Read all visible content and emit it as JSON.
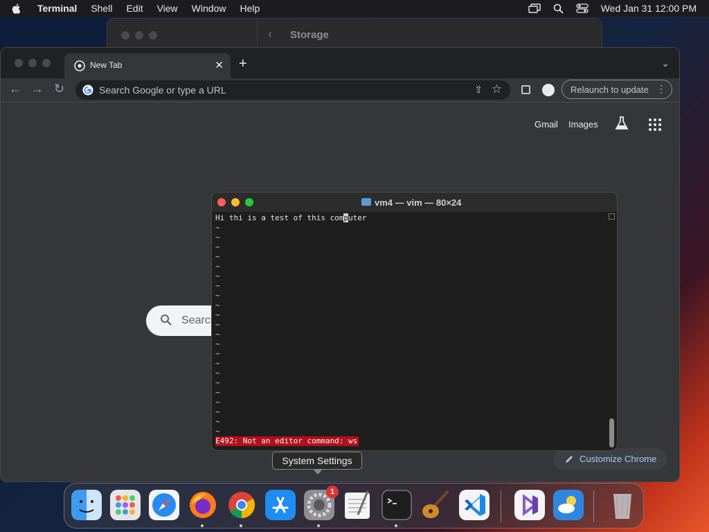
{
  "menubar": {
    "app_name": "Terminal",
    "items": [
      "Shell",
      "Edit",
      "View",
      "Window",
      "Help"
    ],
    "clock": "Wed Jan 31  12:00 PM"
  },
  "storage_window": {
    "title": "Storage"
  },
  "chrome": {
    "tab_title": "New Tab",
    "omnibox_placeholder": "Search Google or type a URL",
    "relaunch_label": "Relaunch to update",
    "links": {
      "gmail": "Gmail",
      "images": "Images"
    },
    "search_text": "Search",
    "customize_label": "Customize Chrome"
  },
  "terminal": {
    "title": "vm4 — vim — 80×24",
    "line1_before": "Hi thi is a test of this com",
    "line1_cursor": "p",
    "line1_after": "uter",
    "tilde": "~",
    "error": "E492: Not an editor command: ws"
  },
  "tooltip": {
    "text": "System Settings"
  },
  "dock": {
    "badge": "1",
    "apps": [
      "Finder",
      "Launchpad",
      "Safari",
      "Firefox",
      "Google Chrome",
      "App Store",
      "System Settings",
      "TextEdit",
      "Terminal",
      "GarageBand",
      "Visual Studio Code",
      "Visual Studio",
      "Weather",
      "Trash"
    ]
  },
  "colors": {
    "error_bg": "#b3101a",
    "chrome_bg": "#35363a",
    "customize_text": "#a8c7fa"
  }
}
